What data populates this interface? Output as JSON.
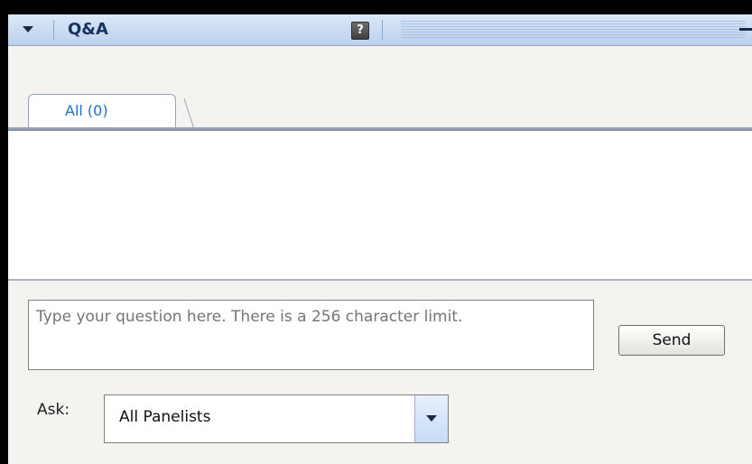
{
  "titlebar": {
    "title": "Q&A",
    "help_label": "?"
  },
  "icons": {
    "collapse": "chevron-down-icon",
    "help": "help-icon",
    "minimize": "minimize-icon",
    "dropdown": "chevron-down-icon"
  },
  "tabs": [
    {
      "label": "All (0)",
      "selected": true
    }
  ],
  "question": {
    "placeholder": "Type your question here. There is a 256 character limit.",
    "value": ""
  },
  "send": {
    "label": "Send"
  },
  "ask": {
    "label": "Ask:",
    "selected": "All Panelists"
  },
  "colors": {
    "titlebar": "#c9dbf1",
    "tab_text": "#1f6fd0",
    "panel_bg": "#f4f3ef",
    "title_text": "#17325e"
  }
}
